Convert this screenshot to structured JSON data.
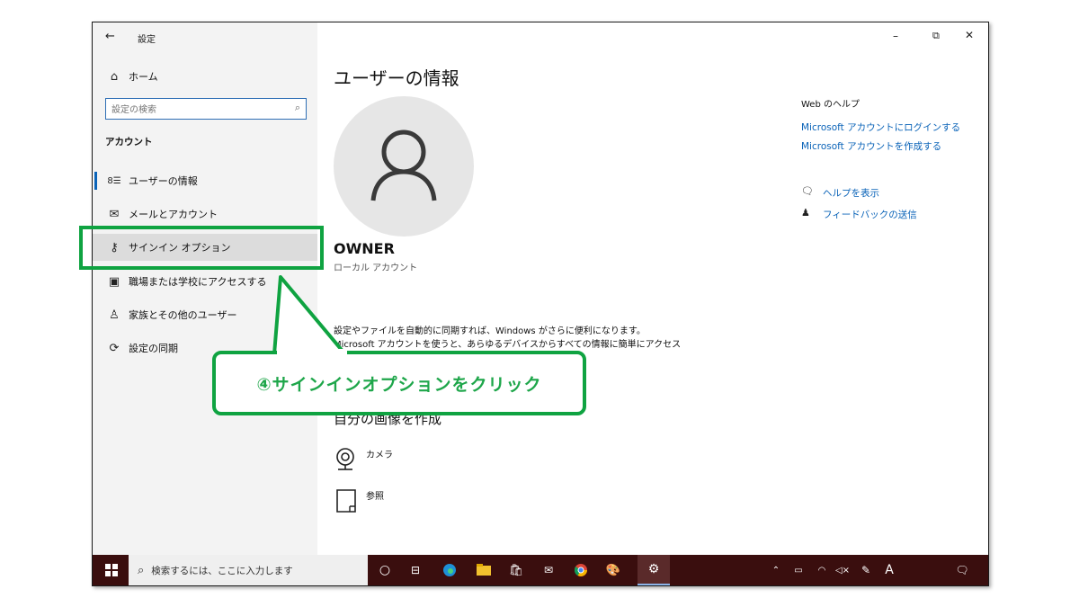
{
  "window": {
    "title": "設定",
    "back_icon": "arrow-left-icon",
    "controls": {
      "minimize": "–",
      "restore": "⧉",
      "close": "✕"
    }
  },
  "sidebar": {
    "home_label": "ホーム",
    "search_placeholder": "設定の検索",
    "section_title": "アカウント",
    "items": [
      {
        "icon": "user-info-icon",
        "glyph": "8☰",
        "label": "ユーザーの情報"
      },
      {
        "icon": "mail-icon",
        "glyph": "✉",
        "label": "メールとアカウント"
      },
      {
        "icon": "key-icon",
        "glyph": "⚷",
        "label": "サインイン オプション"
      },
      {
        "icon": "briefcase-icon",
        "glyph": "▣",
        "label": "職場または学校にアクセスする"
      },
      {
        "icon": "family-icon",
        "glyph": "♙",
        "label": "家族とその他のユーザー"
      },
      {
        "icon": "sync-icon",
        "glyph": "⟳",
        "label": "設定の同期"
      }
    ]
  },
  "main": {
    "page_title": "ユーザーの情報",
    "user_name": "OWNER",
    "account_type": "ローカル アカウント",
    "sync_text_line1": "設定やファイルを自動的に同期すれば、Windows がさらに便利になります。",
    "sync_text_line2": "Microsoft アカウントを使うと、あらゆるデバイスからすべての情報に簡単にアクセス",
    "create_picture_title": "自分の画像を作成",
    "camera_label": "カメラ",
    "browse_label": "参照"
  },
  "right_panel": {
    "help_title": "Web のヘルプ",
    "link_signin": "Microsoft アカウントにログインする",
    "link_create": "Microsoft アカウントを作成する",
    "help_show": "ヘルプを表示",
    "feedback": "フィードバックの送信"
  },
  "taskbar": {
    "search_placeholder": "検索するには、ここに入力します",
    "ime_label": "A",
    "colors": {
      "bg": "#3a0e0e",
      "accent": "#0fa341"
    }
  },
  "annotation": {
    "callout_text": "④サインインオプションをクリック",
    "color": "#0fa341"
  }
}
